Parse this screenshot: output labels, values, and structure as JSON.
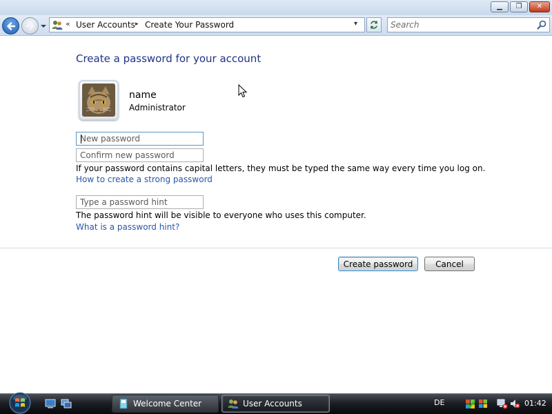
{
  "titlebar": {
    "minimize_glyph": "▁",
    "maximize_glyph": "❐",
    "close_glyph": "✕"
  },
  "navbar": {
    "breadcrumb_chevron": "«",
    "breadcrumbs": [
      "User Accounts",
      "Create Your Password"
    ],
    "separator": "▸",
    "dropdown_glyph": "▾",
    "search_placeholder": "Search"
  },
  "main": {
    "heading": "Create a password for your account",
    "user": {
      "name": "name",
      "role": "Administrator"
    },
    "new_password_placeholder": "New password",
    "confirm_password_placeholder": "Confirm new password",
    "capital_letters_note": "If your password contains capital letters, they must be typed the same way every time you log on.",
    "strong_password_link": "How to create a strong password",
    "hint_placeholder": "Type a password hint",
    "hint_note": "The password hint will be visible to everyone who uses this computer.",
    "hint_link": "What is a password hint?",
    "create_button": "Create password",
    "cancel_button": "Cancel"
  },
  "taskbar": {
    "tasks": [
      {
        "label": "Welcome Center",
        "active": false
      },
      {
        "label": "User Accounts",
        "active": true
      }
    ],
    "language": "DE",
    "clock": "01:42"
  },
  "colors": {
    "heading": "#1e3287",
    "link": "#2a56a8",
    "accent_button_border": "#3c7fb1"
  }
}
